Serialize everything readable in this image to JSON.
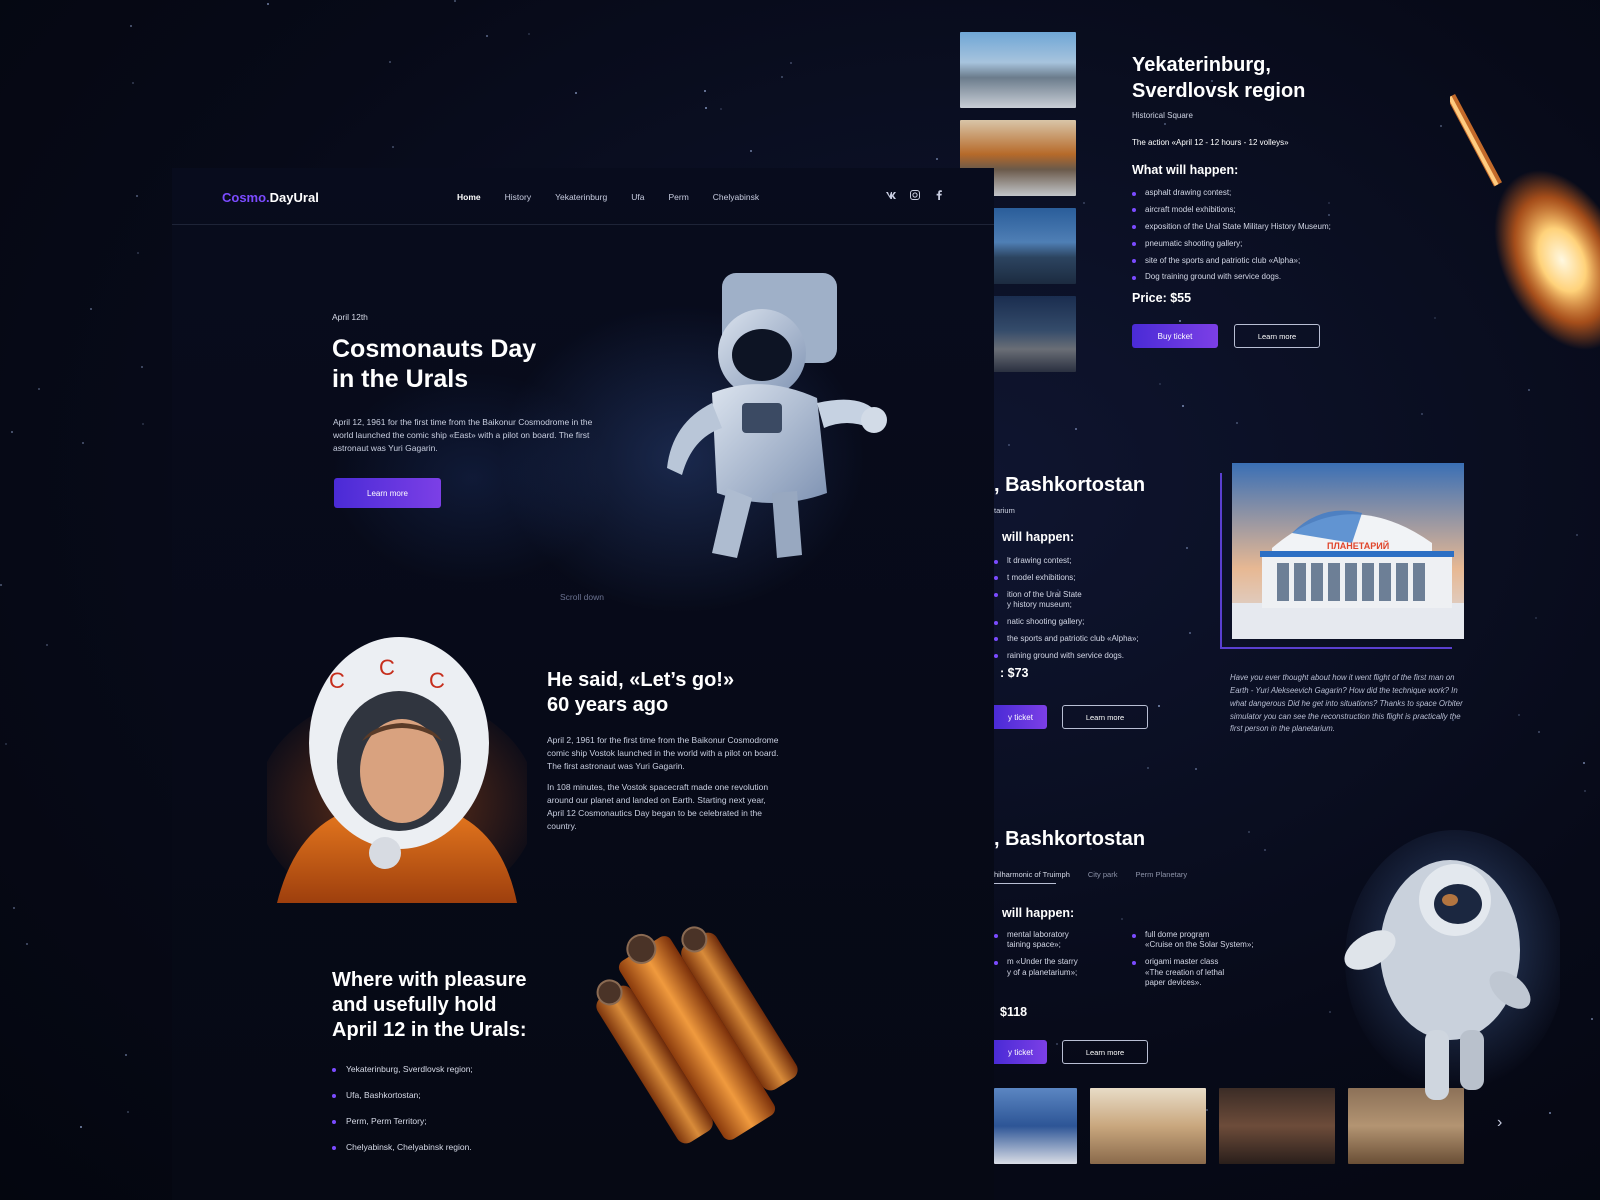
{
  "nav": {
    "logo_prefix": "Cosmo.",
    "logo_suffix": "DayUral",
    "links": [
      "Home",
      "History",
      "Yekaterinburg",
      "Ufa",
      "Perm",
      "Chelyabinsk"
    ],
    "social_icons": [
      "vk-icon",
      "instagram-icon",
      "facebook-icon"
    ]
  },
  "hero": {
    "date": "April 12th",
    "title_line1": "Cosmonauts Day",
    "title_line2": "in the Urals",
    "text": "April 12, 1961 for the first time from the Baikonur Cosmodrome in the world launched the comic ship «East» with a pilot on board. The first astronaut was Yuri Gagarin.",
    "button": "Learn more",
    "scroll": "Scroll down"
  },
  "history": {
    "title_line1": "He said, «Let’s go!»",
    "title_line2": "60 years ago",
    "p1": "April 2, 1961 for the first time from the Baikonur Cosmodrome comic ship Vostok launched in the world with a pilot on board. The first astronaut was Yuri Gagarin.",
    "p2": "In 108 minutes, the Vostok spacecraft made one revolution around our planet and landed on Earth. Starting next year, April 12 Cosmonautics Day began to be celebrated in the country."
  },
  "where": {
    "title_line1": "Where with pleasure",
    "title_line2": "and usefully hold",
    "title_line3": "April 12 in the Urals:",
    "items": [
      "Yekaterinburg, Sverdlovsk region;",
      "Ufa, Bashkortostan;",
      "Perm, Perm Territory;",
      "Chelyabinsk, Chelyabinsk region."
    ]
  },
  "yekaterinburg": {
    "title_line1": "Yekaterinburg,",
    "title_line2": "Sverdlovsk region",
    "venue": "Historical Square",
    "action": "The action «April 12 - 12 hours - 12 volleys»",
    "what": "What will happen:",
    "items": [
      "asphalt drawing contest;",
      "aircraft model exhibitions;",
      "exposition of the Ural State Military History Museum;",
      "pneumatic shooting gallery;",
      "site of the sports and patriotic club «Alpha»;",
      "Dog training ground with service dogs."
    ],
    "price": "Price: $55",
    "buy": "Buy ticket",
    "learn": "Learn more"
  },
  "ufa": {
    "title": ", Bashkortostan",
    "venue": "tarium",
    "what": "will happen:",
    "items": [
      "lt drawing contest;",
      "t model exhibitions;",
      "ition of the Ural State\ny history museum;",
      "natic shooting gallery;",
      "the sports and patriotic club «Alpha»;",
      "raining ground with service dogs."
    ],
    "price": ": $73",
    "buy": "y ticket",
    "learn": "Learn more",
    "quote": "Have you ever thought about how it went flight of the first man on Earth - Yuri Alekseevich Gagarin? How did the technique work? In what dangerous Did he get into situations? Thanks to space Orbiter simulator you can see the reconstruction this flight is practically the first person in the planetarium."
  },
  "perm": {
    "title": ", Bashkortostan",
    "tabs": [
      "hilharmonic of Truimph",
      "City park",
      "Perm Planetary"
    ],
    "what": "will happen:",
    "col1": [
      "mental laboratory\ntaining space»;",
      "m «Under the starry\ny of a planetarium»;"
    ],
    "col2": [
      "full dome program\n«Cruise on the Solar System»;",
      "origami master class\n«The creation of lethal\npaper devices»."
    ],
    "price": "$118",
    "buy": "y ticket",
    "learn": "Learn more"
  },
  "colors": {
    "accent": "#7b4bff",
    "button_start": "#4a2bd6",
    "button_end": "#7c3fe6"
  }
}
